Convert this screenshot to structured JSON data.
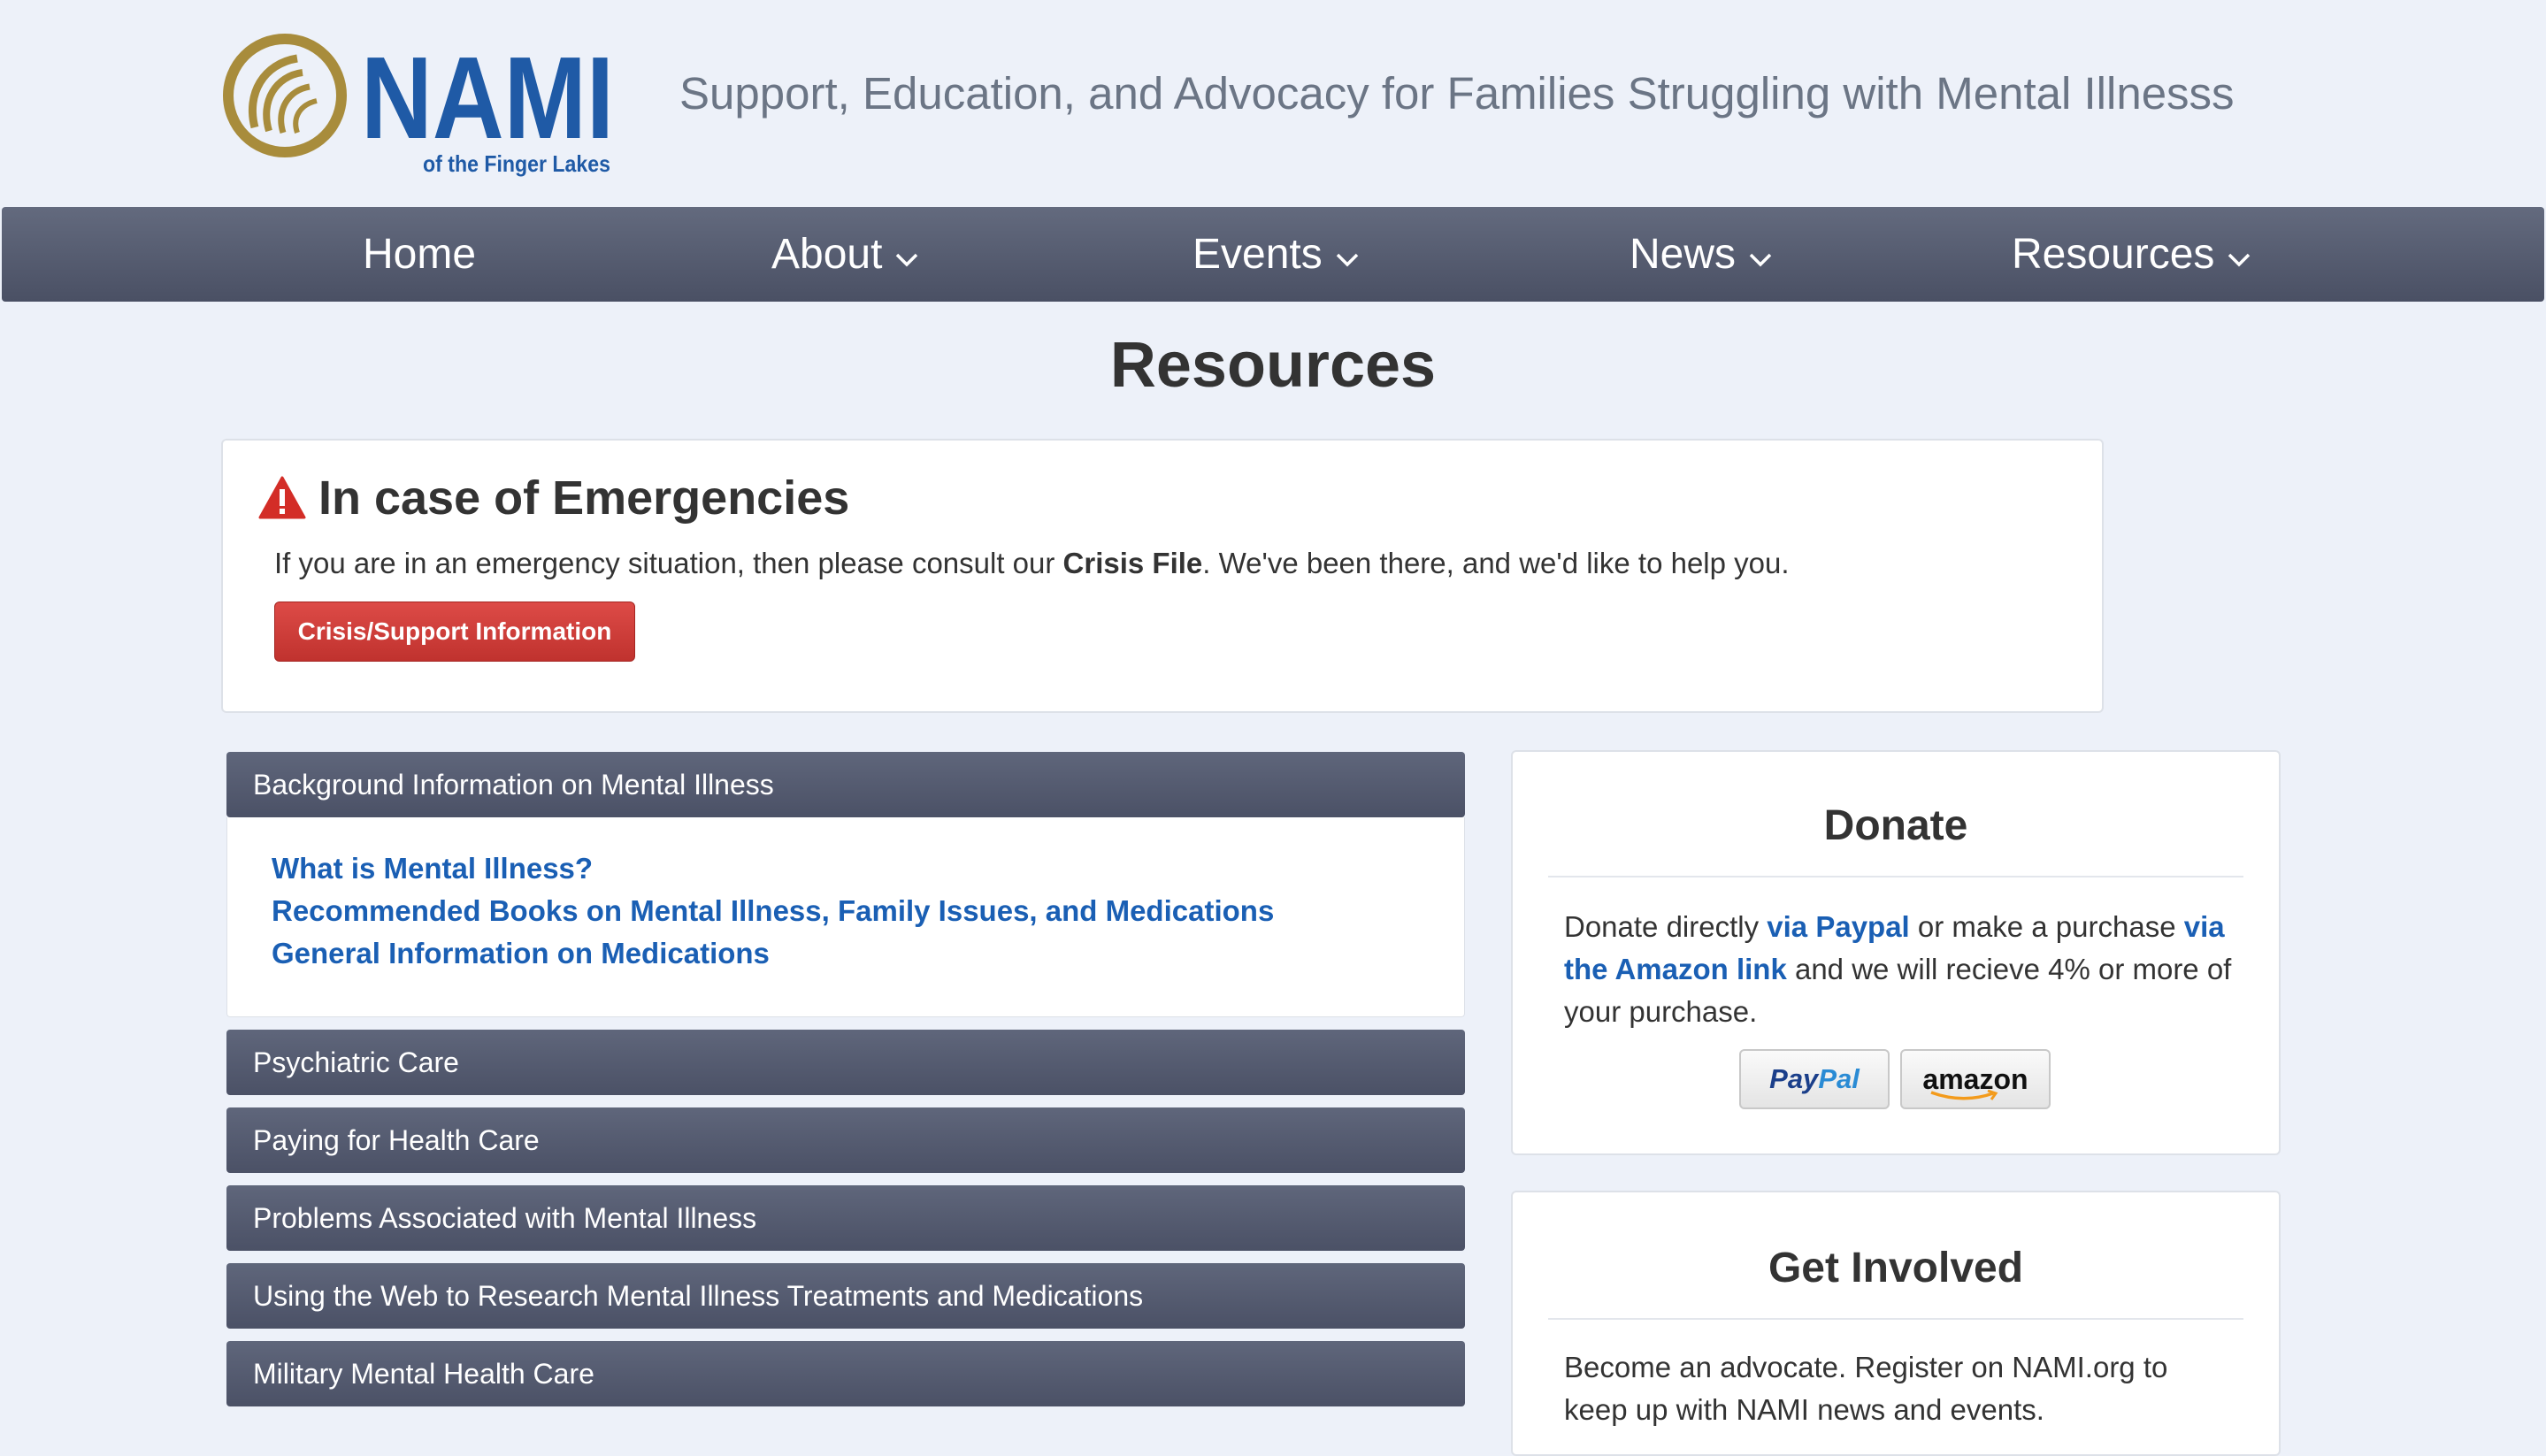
{
  "header": {
    "logo_word": "NAMI",
    "logo_sub": "of the Finger Lakes",
    "tagline": "Support, Education, and Advocacy for Families Struggling with Mental Illnesss"
  },
  "nav": {
    "home": "Home",
    "about": "About",
    "events": "Events",
    "news": "News",
    "resources": "Resources"
  },
  "page_title": "Resources",
  "emergency": {
    "title": "In case of Emergencies",
    "msg_before": "If you are in an emergency situation, then please consult our ",
    "msg_bold": "Crisis File",
    "msg_after": ". We've been there, and we'd like to help you.",
    "button": "Crisis/Support Information"
  },
  "accordion": {
    "background": {
      "label": "Background Information on Mental Illness",
      "links": [
        "What is Mental Illness?",
        "Recommended Books on Mental Illness, Family Issues, and Medications",
        "General Information on Medications"
      ]
    },
    "psychiatric": "Psychiatric Care",
    "paying": "Paying for Health Care",
    "problems": "Problems Associated with Mental Illness",
    "web_research": "Using the Web to Research Mental Illness Treatments and Medications",
    "military": "Military Mental Health Care"
  },
  "donate": {
    "title": "Donate",
    "t1": "Donate directly ",
    "link_paypal": "via Paypal",
    "t2": " or make a purchase ",
    "link_amazon": "via the Amazon link",
    "t3": " and we will recieve 4% or more of your purchase.",
    "paypal_pay": "Pay",
    "paypal_pal": "Pal",
    "amazon_label": "amazon"
  },
  "get_involved": {
    "title": "Get Involved",
    "text": "Become an advocate. Register on NAMI.org to keep up with NAMI news and events."
  },
  "colors": {
    "nav_bg": "#545a6f",
    "link": "#1a5fb4",
    "danger": "#c9302c",
    "page_bg": "#edf1f9"
  }
}
